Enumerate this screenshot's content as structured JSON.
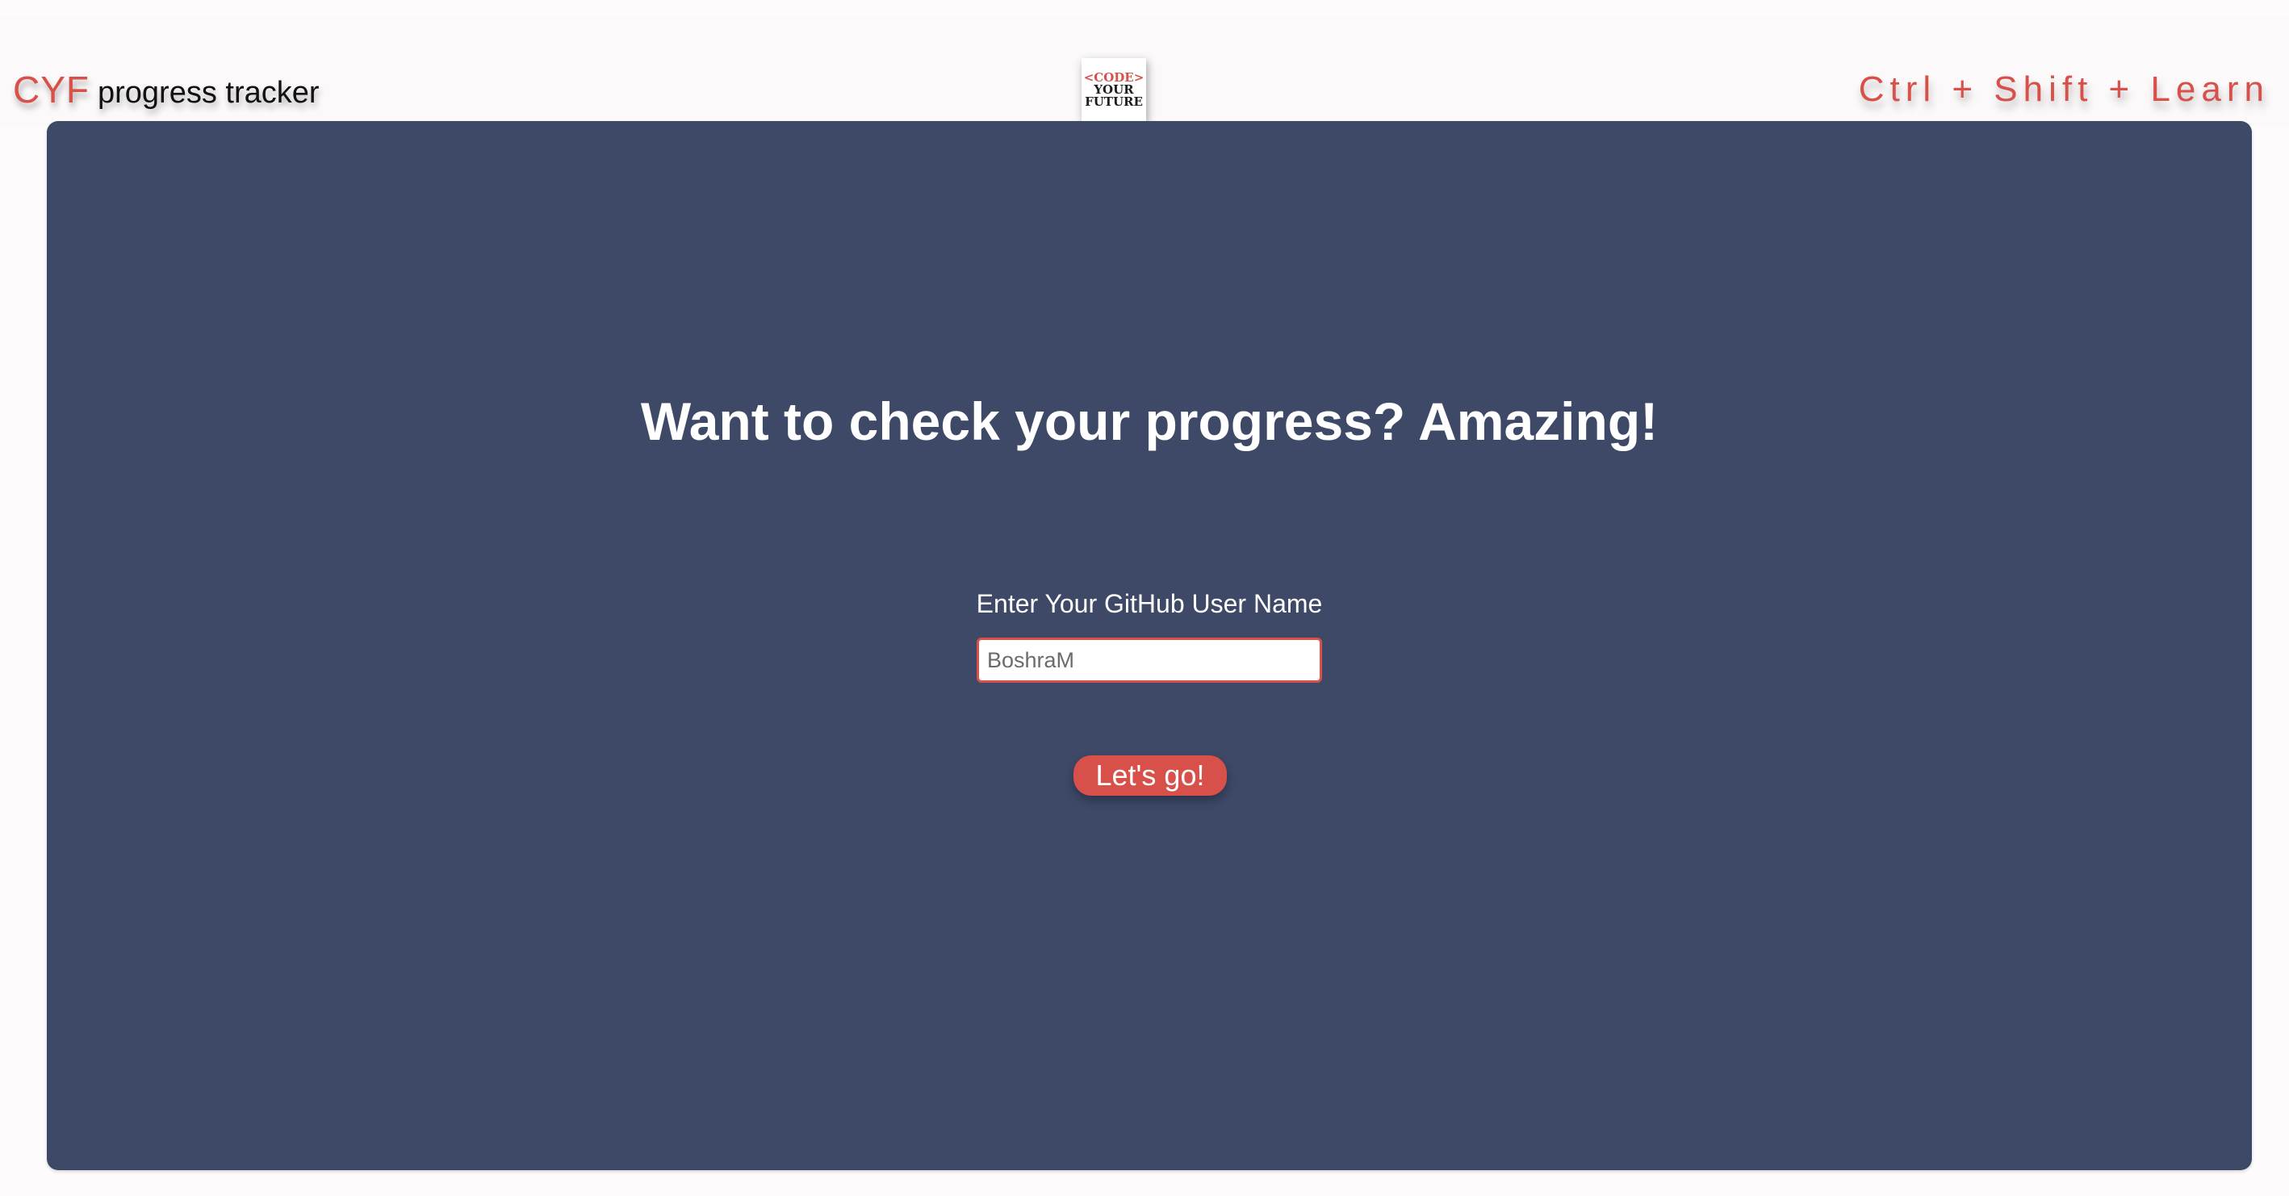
{
  "header": {
    "brand_accent": "CYF",
    "brand_rest": "progress tracker",
    "logo": {
      "line1": "<CODE>",
      "line2": "YOUR",
      "line3": "FUTURE"
    },
    "tagline": "Ctrl + Shift + Learn"
  },
  "main": {
    "headline": "Want to check your progress? Amazing!",
    "username_label": "Enter Your GitHub User Name",
    "username_placeholder": "BoshraM",
    "submit_label": "Let's go!"
  },
  "colors": {
    "accent": "#d8504a",
    "panel": "#3e4968",
    "page_background": "#fdfbfc"
  }
}
